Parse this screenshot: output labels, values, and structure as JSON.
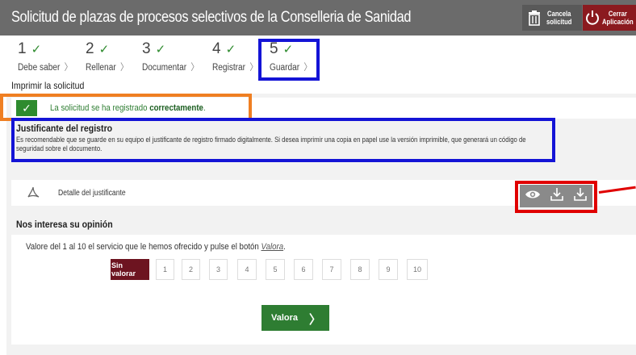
{
  "header": {
    "title": "Solicitud de plazas de procesos selectivos de la Conselleria de Sanidad",
    "cancel_label_1": "Cancela",
    "cancel_label_2": "solicitud",
    "close_label_1": "Cerrar",
    "close_label_2": "Aplicación"
  },
  "steps": [
    {
      "number": "1",
      "label": "Debe saber"
    },
    {
      "number": "2",
      "label": "Rellenar"
    },
    {
      "number": "3",
      "label": "Documentar"
    },
    {
      "number": "4",
      "label": "Registrar"
    },
    {
      "number": "5",
      "label": "Guardar"
    }
  ],
  "section_heading": "Imprimir la solicitud",
  "success": {
    "text_prefix": "La solicitud se ha registrado ",
    "text_bold": "correctamente",
    "text_suffix": "."
  },
  "justificante": {
    "title": "Justificante del registro",
    "description": "Es recomendable que se guarde en su equipo el justificante de registro firmado digitalmente. Si desea imprimir una copia en papel use la versión imprimible, que generará un código de seguridad sobre el documento."
  },
  "detail": {
    "label": "Detalle del justificante"
  },
  "opinion": {
    "title": "Nos interesa su opinión",
    "text_prefix": "Valore del 1 al 10 el servicio que le hemos ofrecido y pulse el botón ",
    "link": "Valora",
    "text_suffix": ".",
    "scores": [
      "Sin valorar",
      "1",
      "2",
      "3",
      "4",
      "5",
      "6",
      "7",
      "8",
      "9",
      "10"
    ],
    "selected": "Sin valorar",
    "submit_label": "Valora"
  },
  "colors": {
    "header_bg": "#6b6b6b",
    "success_green": "#2e8b2e",
    "score_selected": "#6d1420",
    "annotation_blue": "#1414d6",
    "annotation_orange": "#ef7f22",
    "annotation_red": "#e00000"
  }
}
